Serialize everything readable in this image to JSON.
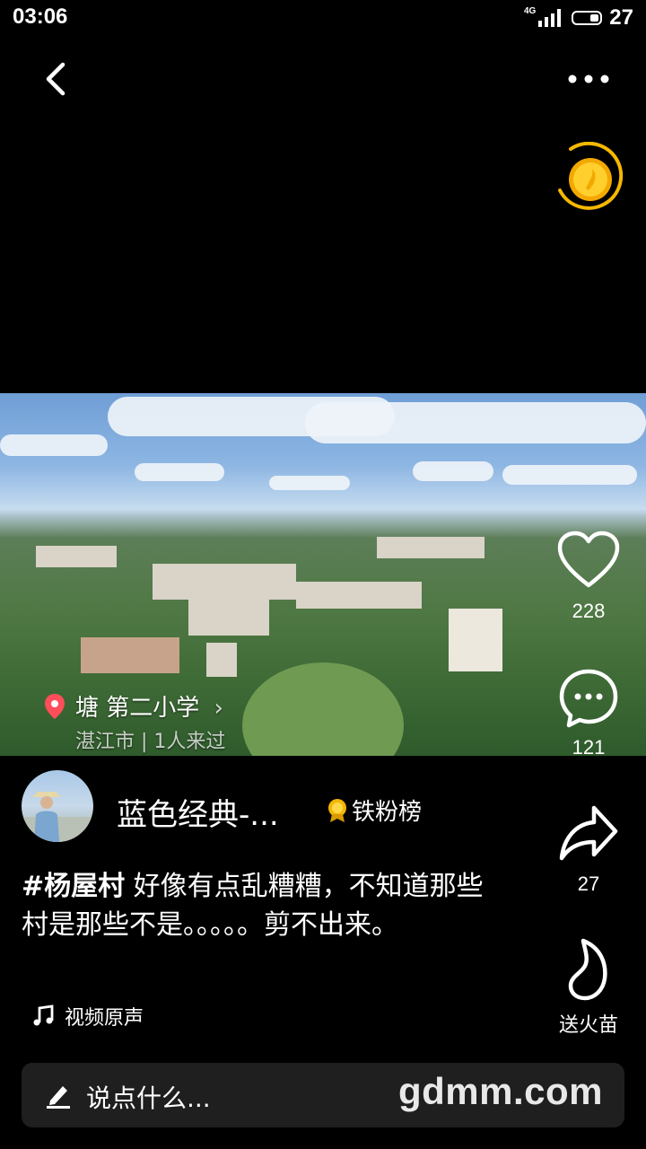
{
  "status_bar": {
    "time": "03:06",
    "network": "4G",
    "battery": "27"
  },
  "top_bar": {
    "back_icon": "chevron-left-icon",
    "more_icon": "more-dots-icon",
    "coin_icon": "gold-coin-icon"
  },
  "location": {
    "name": "塘 第二小学",
    "sub": "湛江市 | 1人来过",
    "icon": "location-pin-icon"
  },
  "actions": {
    "like_count": "228",
    "comment_count": "121",
    "share_count": "27",
    "gift_label": "送火苗"
  },
  "author": {
    "name": "蓝色经典-...",
    "badge": "铁粉榜"
  },
  "caption": {
    "hashtag": "#杨屋村",
    "text": " 好像有点乱糟糟，不知道那些村是那些不是。。。。。剪不出来。"
  },
  "music": {
    "label": "视频原声",
    "icon": "music-note-icon"
  },
  "comment_input": {
    "placeholder": "说点什么...",
    "icon": "pencil-icon"
  },
  "watermark": "gdmm.com",
  "colors": {
    "background": "#000000",
    "location_pin": "#ff4d5a",
    "coin": "#f5b800",
    "comment_bar": "#1f1f1f"
  }
}
